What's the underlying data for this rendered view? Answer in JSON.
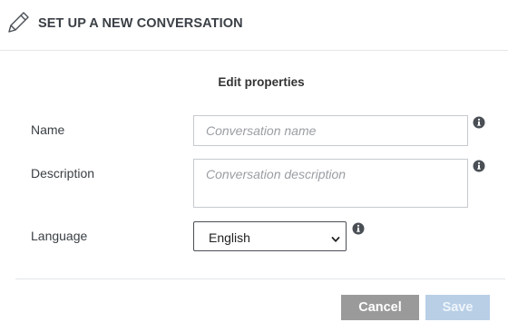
{
  "header": {
    "icon": "pencil-icon",
    "title": "SET UP A NEW CONVERSATION"
  },
  "form": {
    "section_title": "Edit properties",
    "name": {
      "label": "Name",
      "value": "",
      "placeholder": "Conversation name"
    },
    "description": {
      "label": "Description",
      "value": "",
      "placeholder": "Conversation description"
    },
    "language": {
      "label": "Language",
      "selected": "English"
    },
    "info_icon": "info-circle-icon"
  },
  "footer": {
    "cancel_label": "Cancel",
    "save_label": "Save",
    "save_enabled": false
  },
  "colors": {
    "cancel_bg": "#9a9a9a",
    "save_bg_disabled": "#b8cfe6",
    "info_icon": "#4a4f55"
  }
}
